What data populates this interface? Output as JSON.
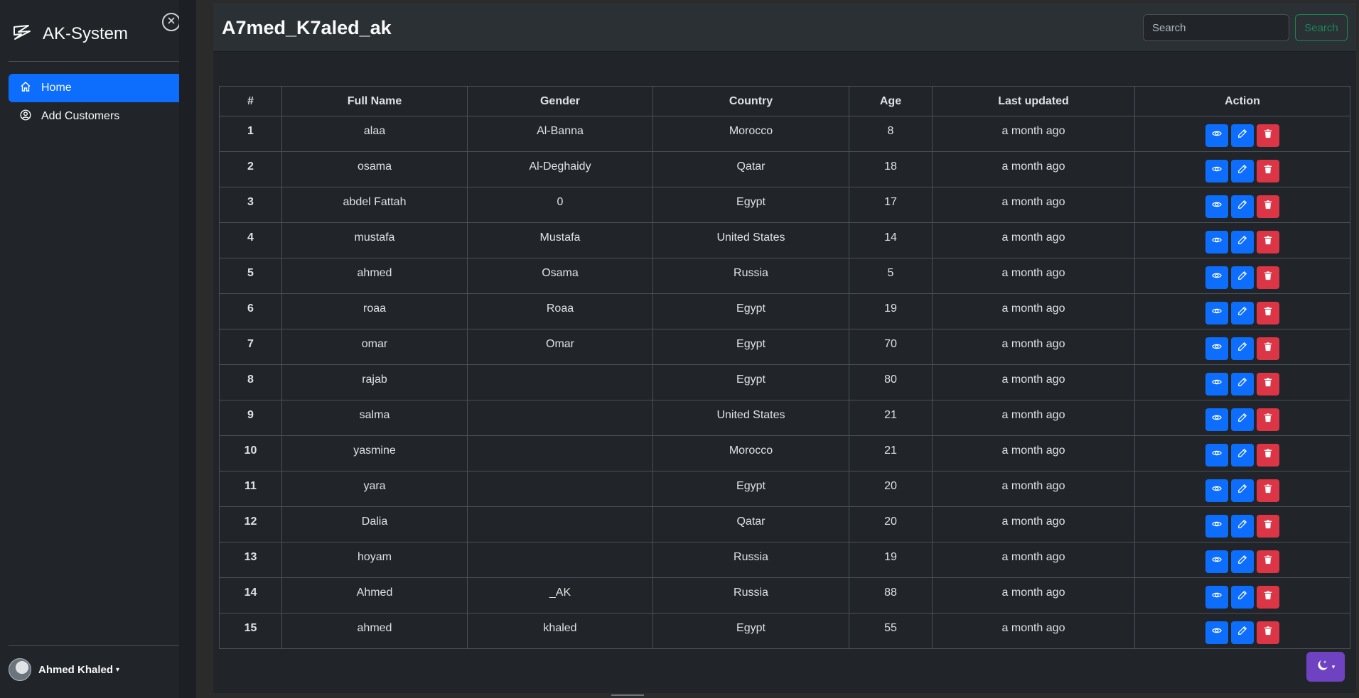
{
  "sidebar": {
    "brand": "AK-System",
    "nav": [
      {
        "label": "Home",
        "active": true,
        "icon": "home-icon"
      },
      {
        "label": "Add Customers",
        "active": false,
        "icon": "user-circle-icon"
      }
    ],
    "user_name": "Ahmed Khaled"
  },
  "header": {
    "title": "A7med_K7aled_ak",
    "search_placeholder": "Search",
    "search_button": "Search"
  },
  "table": {
    "columns": [
      "#",
      "Full Name",
      "Gender",
      "Country",
      "Age",
      "Last updated",
      "Action"
    ],
    "rows": [
      {
        "num": "1",
        "name": "alaa",
        "gender": "Al-Banna",
        "country": "Morocco",
        "age": "8",
        "updated": "a month ago"
      },
      {
        "num": "2",
        "name": "osama",
        "gender": "Al-Deghaidy",
        "country": "Qatar",
        "age": "18",
        "updated": "a month ago"
      },
      {
        "num": "3",
        "name": "abdel Fattah",
        "gender": "0",
        "country": "Egypt",
        "age": "17",
        "updated": "a month ago"
      },
      {
        "num": "4",
        "name": "mustafa",
        "gender": "Mustafa",
        "country": "United States",
        "age": "14",
        "updated": "a month ago"
      },
      {
        "num": "5",
        "name": "ahmed",
        "gender": "Osama",
        "country": "Russia",
        "age": "5",
        "updated": "a month ago"
      },
      {
        "num": "6",
        "name": "roaa",
        "gender": "Roaa",
        "country": "Egypt",
        "age": "19",
        "updated": "a month ago"
      },
      {
        "num": "7",
        "name": "omar",
        "gender": "Omar",
        "country": "Egypt",
        "age": "70",
        "updated": "a month ago"
      },
      {
        "num": "8",
        "name": "rajab",
        "gender": "",
        "country": "Egypt",
        "age": "80",
        "updated": "a month ago"
      },
      {
        "num": "9",
        "name": "salma",
        "gender": "",
        "country": "United States",
        "age": "21",
        "updated": "a month ago"
      },
      {
        "num": "10",
        "name": "yasmine",
        "gender": "",
        "country": "Morocco",
        "age": "21",
        "updated": "a month ago"
      },
      {
        "num": "11",
        "name": "yara",
        "gender": "",
        "country": "Egypt",
        "age": "20",
        "updated": "a month ago"
      },
      {
        "num": "12",
        "name": "Dalia",
        "gender": "",
        "country": "Qatar",
        "age": "20",
        "updated": "a month ago"
      },
      {
        "num": "13",
        "name": "hoyam",
        "gender": "",
        "country": "Russia",
        "age": "19",
        "updated": "a month ago"
      },
      {
        "num": "14",
        "name": "Ahmed",
        "gender": "_AK",
        "country": "Russia",
        "age": "88",
        "updated": "a month ago"
      },
      {
        "num": "15",
        "name": "ahmed",
        "gender": "khaled",
        "country": "Egypt",
        "age": "55",
        "updated": "a month ago"
      }
    ],
    "action_icons": [
      "eye-icon",
      "pencil-icon",
      "trash-icon"
    ]
  },
  "theme": {
    "icon": "moon-stars-icon",
    "accent": "#6f42c1"
  },
  "colors": {
    "primary": "#0d6efd",
    "danger": "#dc3545",
    "success": "#198754",
    "bg": "#212529"
  }
}
